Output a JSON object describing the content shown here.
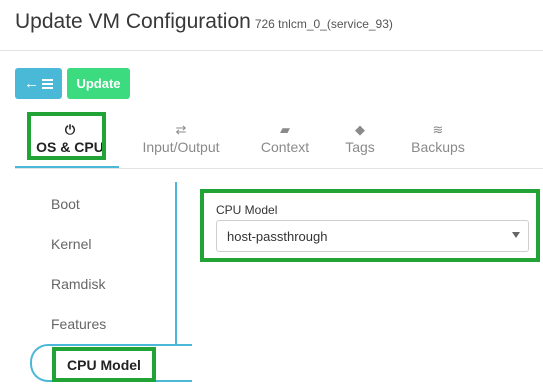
{
  "header": {
    "title": "Update VM Configuration",
    "subtitle": "726 tnlcm_0_(service_93)"
  },
  "toolbar": {
    "back_icon": "back-list-icon",
    "update_label": "Update"
  },
  "tabs": [
    {
      "label": "OS & CPU",
      "icon": "power-icon",
      "glyph": "⏻",
      "active": true
    },
    {
      "label": "Input/Output",
      "icon": "exchange-icon",
      "glyph": "⇄"
    },
    {
      "label": "Context",
      "icon": "folder-icon",
      "glyph": "▰"
    },
    {
      "label": "Tags",
      "icon": "tag-icon",
      "glyph": "◆"
    },
    {
      "label": "Backups",
      "icon": "database-icon",
      "glyph": "≋"
    }
  ],
  "side_menu": {
    "items": [
      "Boot",
      "Kernel",
      "Ramdisk",
      "Features"
    ],
    "active": "CPU Model"
  },
  "cpu_model": {
    "label": "CPU Model",
    "value": "host-passthrough"
  },
  "colors": {
    "accent": "#4ab8d7",
    "update": "#3ddb80",
    "highlight": "#21a336"
  }
}
